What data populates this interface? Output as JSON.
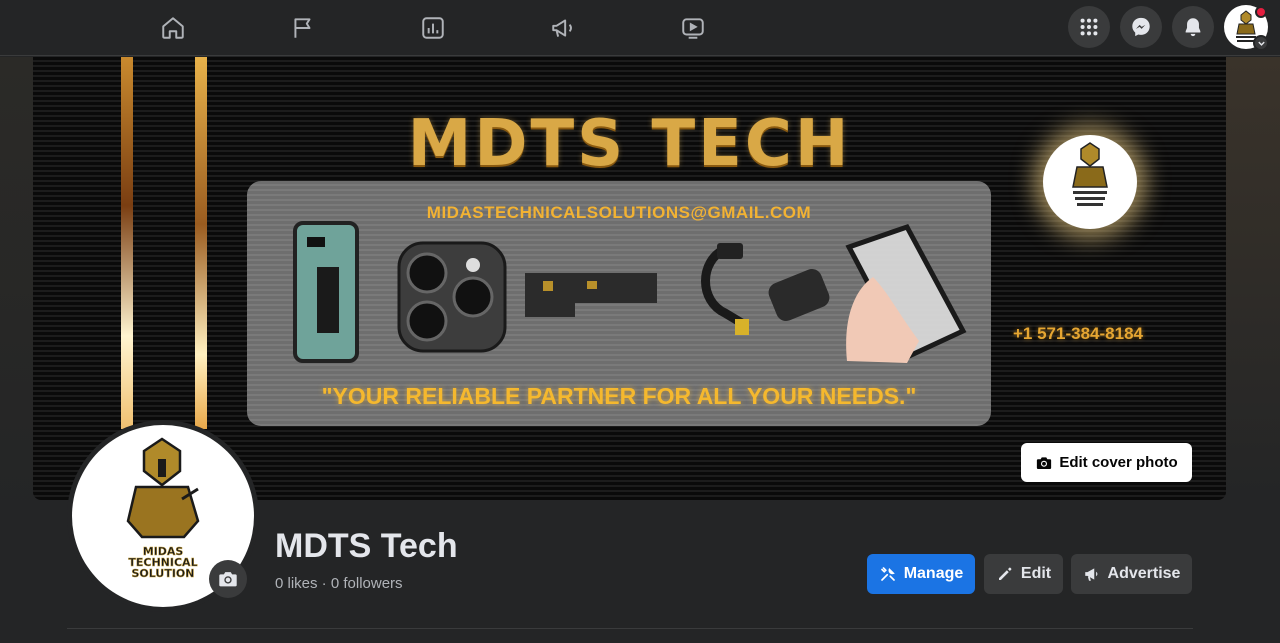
{
  "nav": {
    "tabs": [
      {
        "icon": "home-icon"
      },
      {
        "icon": "flag-icon"
      },
      {
        "icon": "insights-icon"
      },
      {
        "icon": "megaphone-icon"
      },
      {
        "icon": "video-icon"
      }
    ],
    "right": [
      {
        "icon": "menu-grid-icon"
      },
      {
        "icon": "messenger-icon"
      },
      {
        "icon": "bell-icon"
      }
    ]
  },
  "cover": {
    "title": "MDTS TECH",
    "email": "MIDASTECHNICALSOLUTIONS@GMAIL.COM",
    "tagline": "\"YOUR RELIABLE PARTNER FOR ALL YOUR NEEDS.\"",
    "phone": "+1 571-384-8184",
    "edit_label": "Edit cover photo",
    "colors": {
      "gold": "#d9a846",
      "panel": "#757575"
    }
  },
  "logo_text": "MIDAS TECHNICAL SOLUTION",
  "profile": {
    "name": "MDTS Tech",
    "stats": "0 likes · 0 followers"
  },
  "actions": {
    "manage": "Manage",
    "edit": "Edit",
    "advertise": "Advertise"
  },
  "colors": {
    "accent": "#1b74e4",
    "surface": "#242526",
    "button": "#3a3b3c"
  }
}
